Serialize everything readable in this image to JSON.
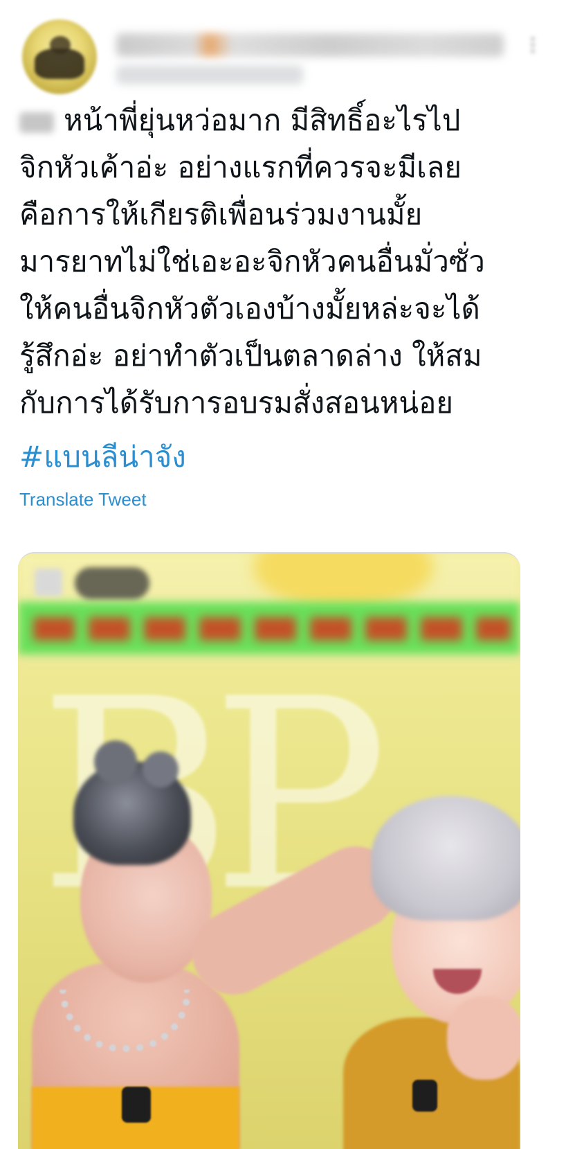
{
  "tweet": {
    "body_lines": [
      "หน้าพี่ยุ่นหว่อมาก มีสิทธิ์อะไรไป",
      "จิกหัวเค้าอ่ะ อย่างแรกที่ควรจะมีเลย",
      "คือการให้เกียรติเพื่อนร่วมงานมั้ย",
      "มารยาทไม่ใช่เอะอะจิกหัวคนอื่นมั่วซั่ว",
      "ให้คนอื่นจิกหัวตัวเองบ้างมั้ยหล่ะจะได้",
      "รู้สึกอ่ะ อย่าทำตัวเป็นตลาดล่าง ให้สม",
      "กับการได้รับการอบรมสั่งสอนหน่อย"
    ],
    "hashtag": "#แบนลีน่าจัง",
    "translate_label": "Translate Tweet"
  },
  "colors": {
    "link": "#2b8ed0",
    "text": "#0f1419"
  },
  "icons": {
    "more": "more-icon"
  }
}
